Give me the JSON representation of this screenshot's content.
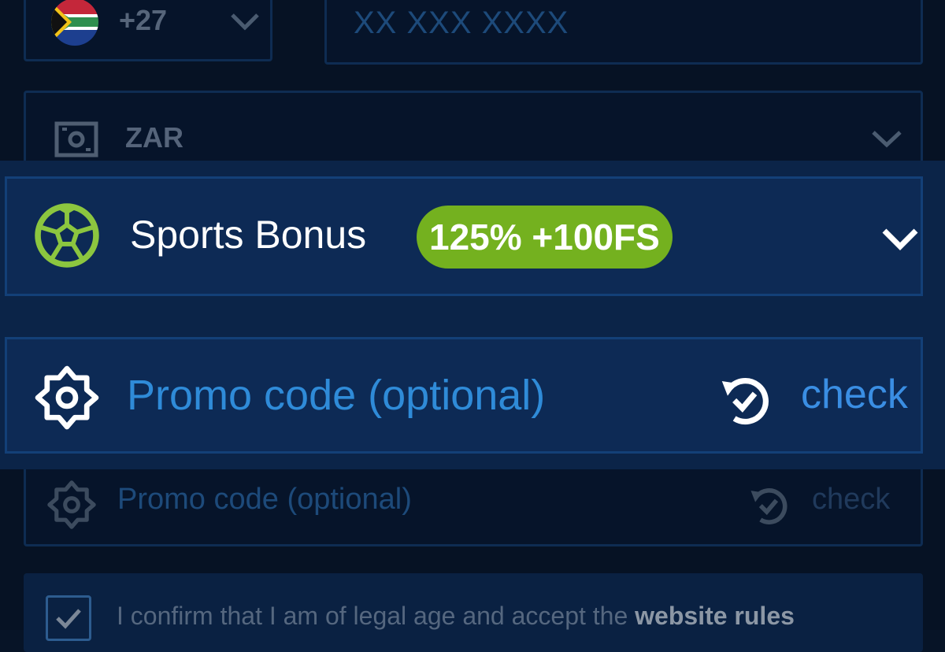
{
  "phone": {
    "country_code": "+27",
    "placeholder": "XX XXX XXXX"
  },
  "currency": {
    "value": "ZAR"
  },
  "bonus": {
    "title": "Sports Bonus",
    "badge": "125% +100FS",
    "accent_color": "#74b11f"
  },
  "promo_active": {
    "placeholder": "Promo code (optional)",
    "check_label": "check"
  },
  "promo_background": {
    "placeholder": "Promo code (optional)",
    "check_label": "check"
  },
  "confirm": {
    "text": "I confirm that I am of legal age and accept the ",
    "link": "website rules"
  },
  "icons": {
    "flag": "south-africa-flag-icon",
    "currency": "banknote-icon",
    "bonus": "soccer-ball-icon",
    "promo": "gear-badge-icon",
    "check": "refresh-check-icon"
  }
}
